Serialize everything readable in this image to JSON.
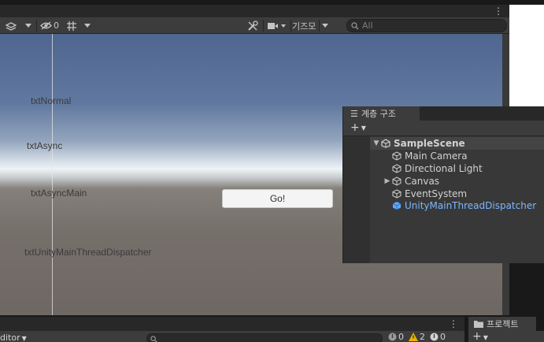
{
  "toolbar": {
    "hidden_count": "0",
    "gizmo_label": "기즈모",
    "search_placeholder": "All"
  },
  "scene": {
    "labels": [
      "txtNormal",
      "txtAsync",
      "txtAsyncMain",
      "txtUnityMainThreadDispatcher"
    ],
    "go_button": "Go!"
  },
  "hierarchy": {
    "tab_label": "계층 구조",
    "scene_name": "SampleScene",
    "items": [
      "Main Camera",
      "Directional Light",
      "Canvas",
      "EventSystem",
      "UnityMainThreadDispatcher"
    ]
  },
  "console": {
    "editor_label": "ditor",
    "log_count": "0",
    "warning_count": "2",
    "error_count": "0"
  },
  "project": {
    "tab_label": "프로젝트"
  },
  "colors": {
    "selected_text": "#7ab8ff",
    "warning": "#e8b400"
  }
}
